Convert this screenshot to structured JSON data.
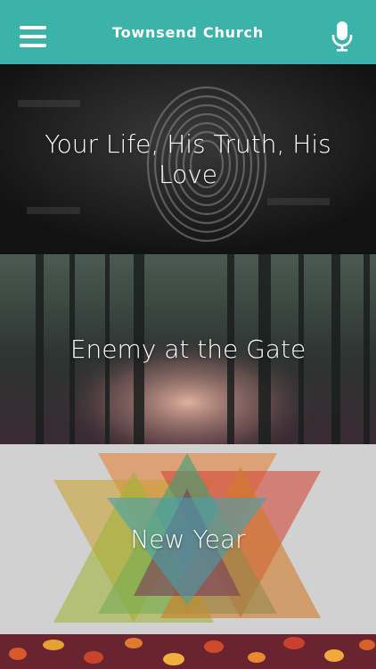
{
  "header": {
    "title": "Townsend Church",
    "menu_icon": "hamburger-menu-icon",
    "mic_icon": "microphone-icon",
    "bg_color": "#3bb3a8"
  },
  "series": [
    {
      "title": "Your Life, His Truth, His Love"
    },
    {
      "title": "Enemy at the Gate"
    },
    {
      "title": "New Year"
    },
    {
      "title": ""
    }
  ]
}
